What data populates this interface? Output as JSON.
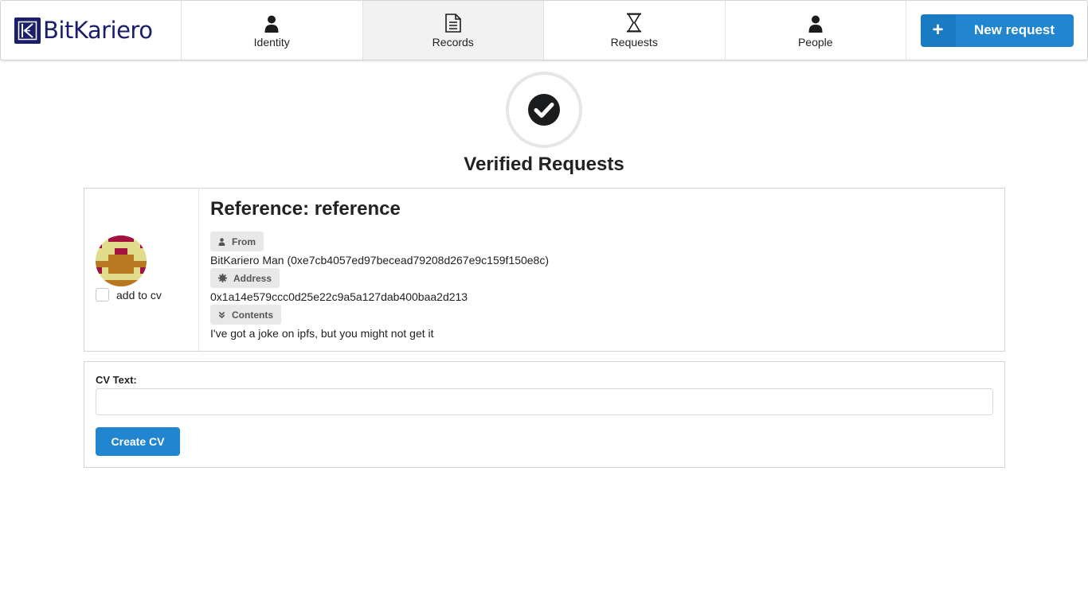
{
  "brand": {
    "name": "BitKariero",
    "color": "#1b1e6d"
  },
  "nav": {
    "items": [
      {
        "label": "Identity",
        "icon": "user-icon",
        "active": false
      },
      {
        "label": "Records",
        "icon": "document-icon",
        "active": true
      },
      {
        "label": "Requests",
        "icon": "hourglass-icon",
        "active": false
      },
      {
        "label": "People",
        "icon": "user-icon",
        "active": false
      }
    ],
    "action": {
      "label": "New request",
      "icon": "plus-icon",
      "symbol": "+"
    }
  },
  "header": {
    "title": "Verified Requests",
    "icon": "check-circle-icon"
  },
  "request": {
    "title": "Reference: reference",
    "add_to_cv_label": "add to cv",
    "add_to_cv_checked": false,
    "from": {
      "label": "From",
      "value": "BitKariero Man (0xe7cb4057ed97becead79208d267e9c159f150e8c)"
    },
    "address": {
      "label": "Address",
      "value": "0x1a14e579ccc0d25e22c9a5a127dab400baa2d213"
    },
    "contents": {
      "label": "Contents",
      "value": "I've got a joke on ipfs, but you might not get it"
    }
  },
  "cv_form": {
    "label": "CV Text:",
    "value": "",
    "placeholder": "",
    "button_label": "Create CV"
  },
  "colors": {
    "primary": "#2185d0",
    "active_tab": "#f2f2f2"
  }
}
